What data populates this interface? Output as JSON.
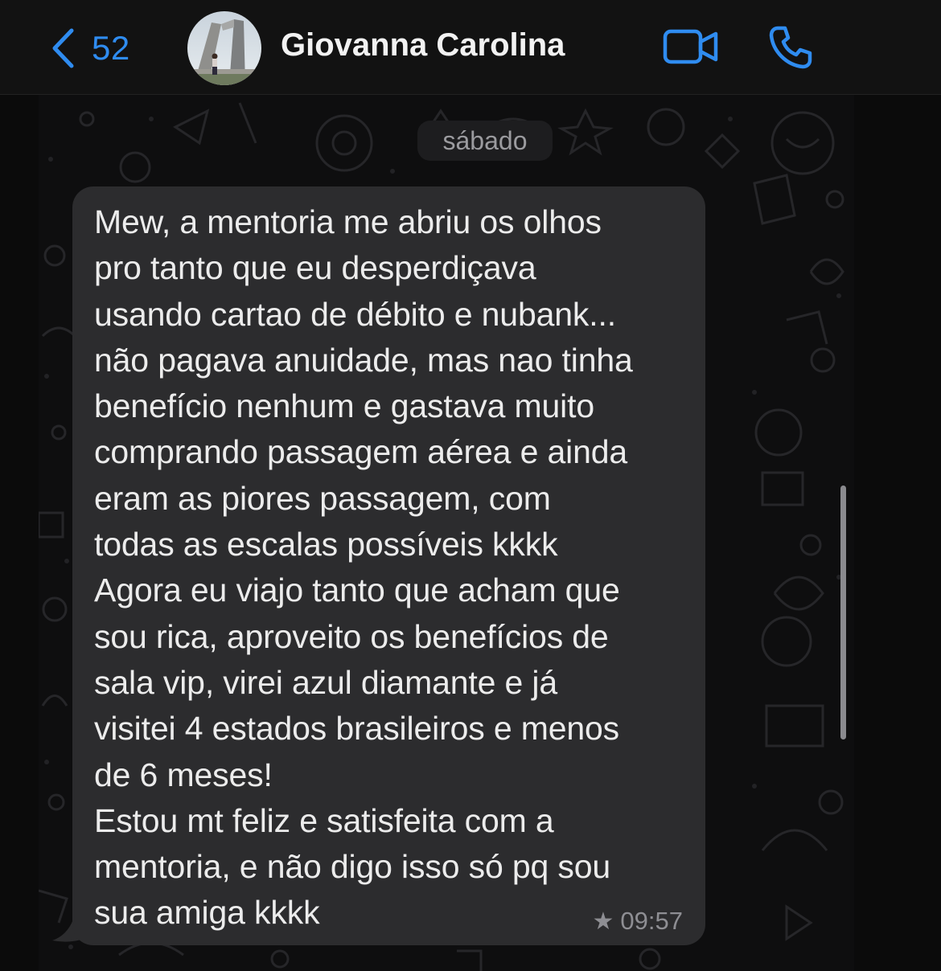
{
  "colors": {
    "accent": "#2f8cf0",
    "bubble": "#2c2c2e",
    "header_bg": "#121212"
  },
  "header": {
    "back_icon": "chevron-left-icon",
    "back_count": "52",
    "contact_name": "Giovanna Carolina",
    "video_icon": "video-camera-icon",
    "call_icon": "phone-icon"
  },
  "chat": {
    "date_separator": "sábado",
    "messages": [
      {
        "text": "Mew, a mentoria me abriu os olhos\npro tanto que eu desperdiçava\nusando cartao de débito e nubank...\nnão pagava anuidade, mas nao tinha\nbenefício nenhum e gastava muito\ncomprando passagem aérea e ainda\neram as piores passagem, com\ntodas as escalas possíveis kkkk\nAgora eu viajo tanto que acham que\nsou rica, aproveito os benefícios de\nsala vip, virei azul diamante e já\nvisitei 4 estados brasileiros e menos\nde 6 meses!\nEstou mt feliz e satisfeita com a\nmentoria, e não digo isso só pq sou\nsua amiga kkkk",
        "starred_icon": "star-icon",
        "time": "09:57"
      }
    ]
  }
}
